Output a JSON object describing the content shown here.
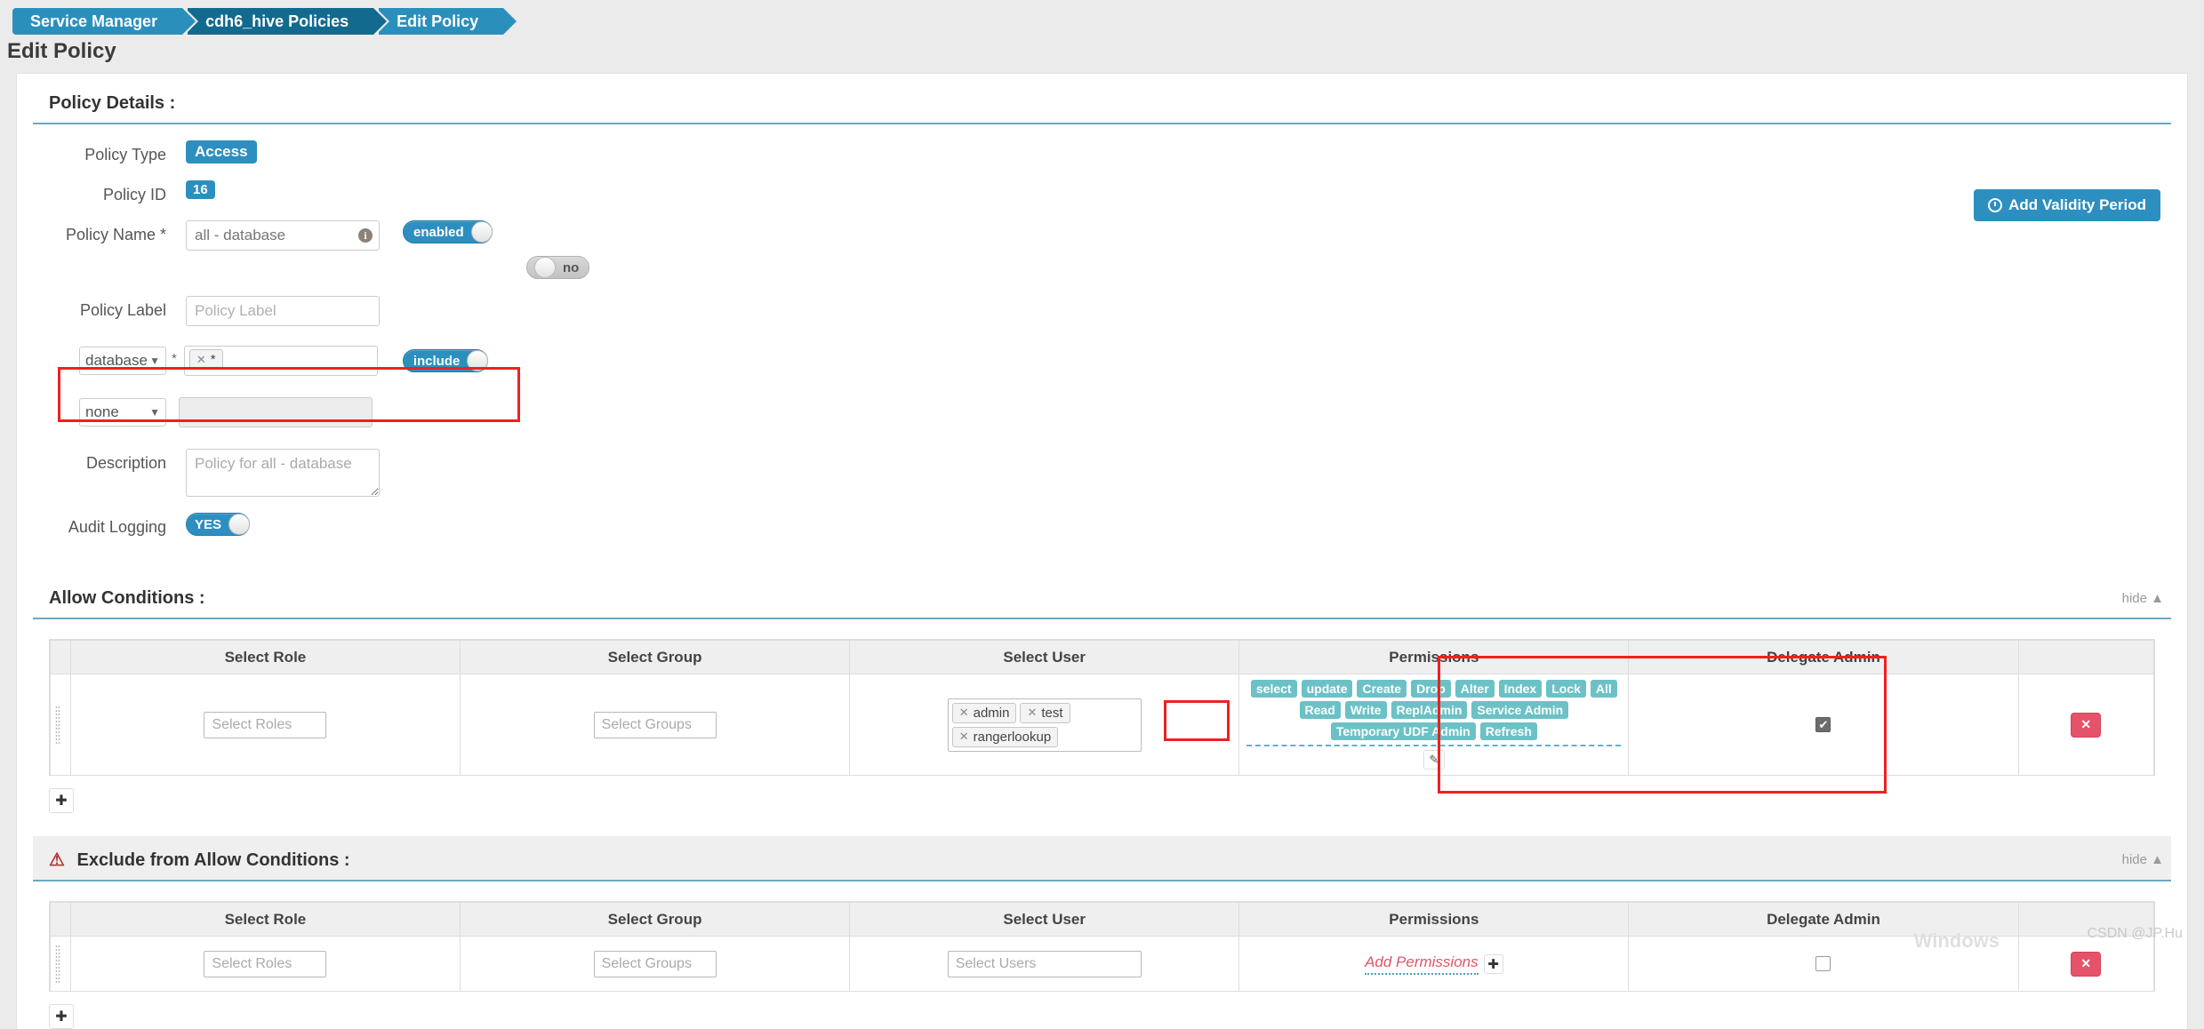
{
  "breadcrumb": [
    {
      "label": "Service Manager",
      "active": false
    },
    {
      "label": "cdh6_hive Policies",
      "active": true
    },
    {
      "label": "Edit Policy",
      "active": false
    }
  ],
  "page_title": "Edit Policy",
  "policy_details": {
    "heading": "Policy Details :",
    "add_validity_label": "Add Validity Period",
    "policy_type_label": "Policy Type",
    "policy_type_value": "Access",
    "policy_id_label": "Policy ID",
    "policy_id_value": "16",
    "policy_name_label": "Policy Name *",
    "policy_name_value": "all - database",
    "policy_name_info_icon": "info-icon",
    "enabled_toggle": "enabled",
    "recursive_toggle": "no",
    "policy_label_label": "Policy Label",
    "policy_label_placeholder": "Policy Label",
    "policy_label_value": "",
    "resource_rows": [
      {
        "type": "database",
        "required": "*",
        "tags": [
          "*"
        ],
        "toggle": "include",
        "toggle_state": "on",
        "disabled": false
      },
      {
        "type": "none",
        "required": "",
        "tags": [],
        "toggle": "",
        "toggle_state": "",
        "disabled": true
      }
    ],
    "description_label": "Description",
    "description_value": "Policy for all - database",
    "audit_logging_label": "Audit Logging",
    "audit_logging_toggle": "YES"
  },
  "allow_conditions": {
    "heading": "Allow Conditions :",
    "hide_label": "hide",
    "hide_icon": "chevron-up-icon",
    "columns": [
      "Select Role",
      "Select Group",
      "Select User",
      "Permissions",
      "Delegate Admin"
    ],
    "row": {
      "role_placeholder": "Select Roles",
      "role_value": "",
      "group_placeholder": "Select Groups",
      "group_value": "",
      "users": [
        "admin",
        "test",
        "rangerlookup"
      ],
      "permissions": [
        "select",
        "update",
        "Create",
        "Drop",
        "Alter",
        "Index",
        "Lock",
        "All",
        "Read",
        "Write",
        "ReplAdmin",
        "Service Admin",
        "Temporary UDF Admin",
        "Refresh"
      ],
      "edit_icon": "pencil-icon",
      "delegate_admin_checked": true,
      "delete_icon": "close-icon"
    },
    "add_row_icon": "plus-icon"
  },
  "exclude_conditions": {
    "heading": "Exclude from Allow Conditions :",
    "warning_icon": "warning-triangle-icon",
    "hide_label": "hide",
    "hide_icon": "chevron-up-icon",
    "columns": [
      "Select Role",
      "Select Group",
      "Select User",
      "Permissions",
      "Delegate Admin"
    ],
    "row": {
      "role_placeholder": "Select Roles",
      "role_value": "",
      "group_placeholder": "Select Groups",
      "group_value": "",
      "user_placeholder": "Select Users",
      "user_value": "",
      "add_permissions_label": "Add Permissions",
      "add_permissions_icon": "plus-icon",
      "delegate_admin_checked": false,
      "delete_icon": "close-icon"
    },
    "add_row_icon": "plus-icon"
  },
  "watermark": "CSDN @JP.Hu",
  "activate_text": "Windows",
  "colors": {
    "accent": "#2d8fbf",
    "permission_badge": "#6cc1c6",
    "danger": "#e4536a",
    "highlight_box": "#f02020"
  }
}
